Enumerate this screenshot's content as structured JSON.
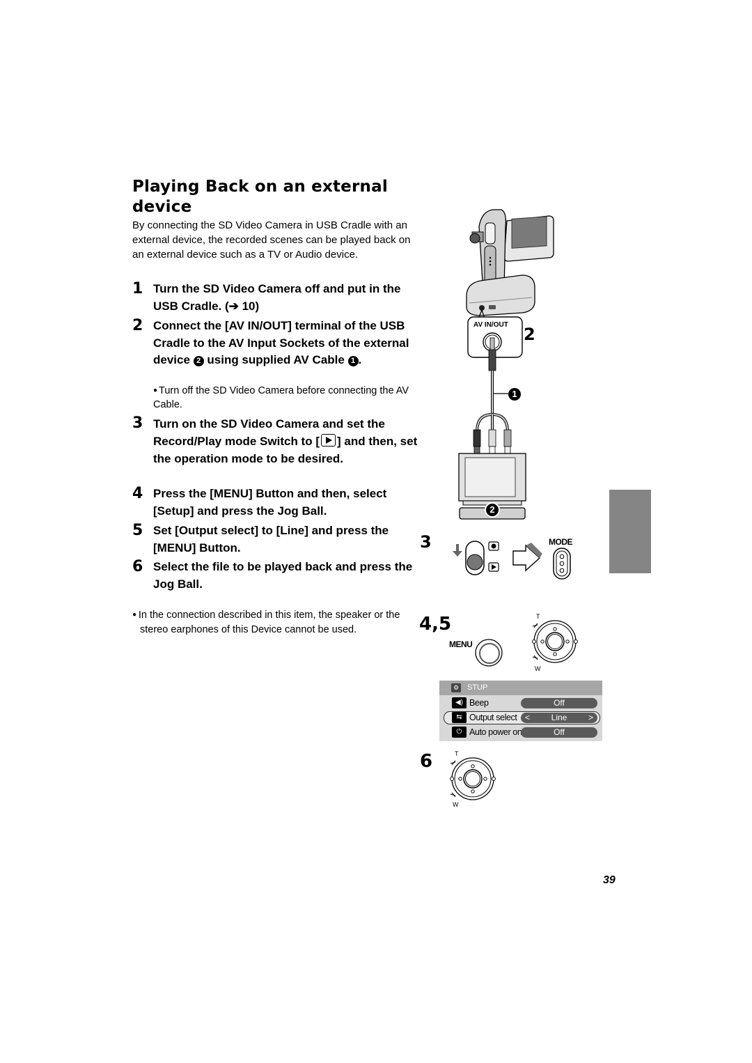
{
  "page": {
    "title": "Playing Back on an external device",
    "intro": "By connecting the SD Video Camera in USB Cradle with an external device, the recorded scenes can be played back on an external device such as a TV or Audio device.",
    "page_number": "39"
  },
  "steps": [
    {
      "num": "1",
      "text_a": "Turn the SD Video Camera off and put in the USB Cradle. (➔ 10)"
    },
    {
      "num": "2",
      "text_a": "Connect the [AV IN/OUT] terminal of the USB Cradle to the AV Input Sockets of the external device ",
      "marker_a": "2",
      "text_b": " using supplied AV Cable ",
      "marker_b": "1",
      "text_c": ".",
      "note": "Turn off the SD Video Camera before connecting the AV Cable."
    },
    {
      "num": "3",
      "text_a": "Turn on the SD Video Camera and set the Record/Play mode Switch to [",
      "icon": "play-mode-icon",
      "text_b": "] and then, set the operation mode to be desired."
    },
    {
      "num": "4",
      "text_a": "Press the [MENU] Button and then, select [Setup] and press the Jog Ball."
    },
    {
      "num": "5",
      "text_a": "Set [Output select] to [Line] and press the [MENU] Button."
    },
    {
      "num": "6",
      "text_a": "Select the file to be played back and press the Jog Ball."
    }
  ],
  "bottom_note": "In the connection described in this item, the speaker or the stereo earphones of this Device cannot be used.",
  "figures": {
    "fig2_label": "2",
    "av_terminal_label": "AV IN/OUT",
    "cable_marker": "1",
    "tv_marker": "2",
    "fig3_label": "3",
    "mode_label": "MODE",
    "fig45_label": "4,5",
    "menu_button_label": "MENU",
    "jog_t": "T",
    "jog_w": "W",
    "fig6_label": "6"
  },
  "settings_menu": {
    "header": "STUP",
    "header_icon": "setup-icon",
    "rows": [
      {
        "icon": "beep-icon",
        "label": "Beep",
        "value": "Off",
        "selected": false
      },
      {
        "icon": "output-select-icon",
        "label": "Output select",
        "value": "Line",
        "selected": true
      },
      {
        "icon": "power-icon",
        "label": "Auto power on",
        "value": "Off",
        "selected": false
      }
    ]
  }
}
